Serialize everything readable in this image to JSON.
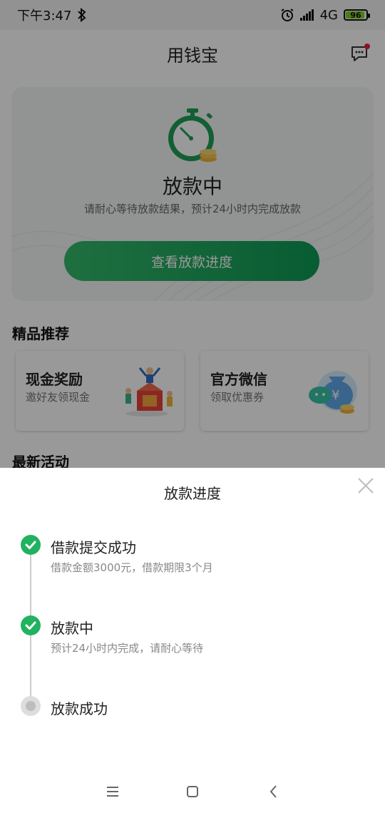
{
  "status_bar": {
    "time": "下午3:47",
    "network": "4G",
    "battery": "96"
  },
  "header": {
    "title": "用钱宝"
  },
  "hero": {
    "status": "放款中",
    "description": "请耐心等待放款结果，预计24小时内完成放款",
    "button_label": "查看放款进度"
  },
  "featured": {
    "title": "精品推荐",
    "cards": [
      {
        "title": "现金奖励",
        "subtitle": "邀好友领现金"
      },
      {
        "title": "官方微信",
        "subtitle": "领取优惠券"
      }
    ]
  },
  "latest": {
    "title": "最新活动"
  },
  "sheet": {
    "title": "放款进度",
    "steps": [
      {
        "title": "借款提交成功",
        "desc": "借款金额3000元，借款期限3个月",
        "state": "done"
      },
      {
        "title": "放款中",
        "desc": "预计24小时内完成，请耐心等待",
        "state": "done"
      },
      {
        "title": "放款成功",
        "desc": "",
        "state": "pending"
      }
    ]
  },
  "colors": {
    "accent_green": "#21b25f",
    "notification_dot": "#e8213f"
  }
}
